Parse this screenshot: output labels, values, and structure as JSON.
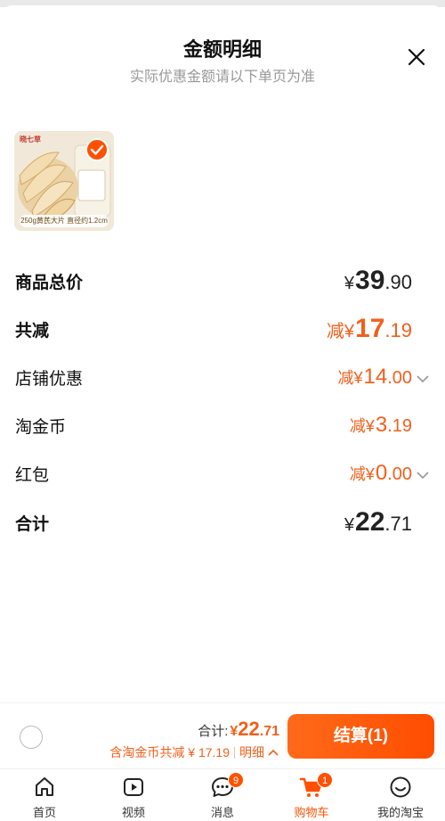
{
  "header": {
    "title": "金额明细",
    "subtitle": "实际优惠金额请以下单页为准"
  },
  "product": {
    "brand": "晓七草",
    "caption": "250g黄芪大片 直径约1.2cm",
    "selected": true
  },
  "rows": {
    "subtotal": {
      "label": "商品总价",
      "prefix": "¥",
      "int": "39",
      "dec": ".90"
    },
    "total_discount": {
      "label": "共减",
      "prefix": "减¥",
      "int": "17",
      "dec": ".19"
    },
    "shop_discount": {
      "label": "店铺优惠",
      "prefix": "减¥",
      "int": "14",
      "dec": ".00"
    },
    "taojinbi": {
      "label": "淘金币",
      "prefix": "减¥",
      "int": "3",
      "dec": ".19"
    },
    "red_packet": {
      "label": "红包",
      "prefix": "减¥",
      "int": "0",
      "dec": ".00"
    },
    "total": {
      "label": "合计",
      "prefix": "¥",
      "int": "22",
      "dec": ".71"
    }
  },
  "footer": {
    "total_label": "合计:",
    "total_prefix": "¥",
    "total_int": "22",
    "total_dec": ".71",
    "note": "含淘金币共减 ¥ 17.19",
    "detail_label": "明细",
    "checkout_label": "结算(1)"
  },
  "tabs": [
    {
      "label": "首页",
      "icon": "home-icon"
    },
    {
      "label": "视频",
      "icon": "video-icon"
    },
    {
      "label": "消息",
      "icon": "message-icon",
      "badge": "9"
    },
    {
      "label": "购物车",
      "icon": "cart-icon",
      "badge": "1",
      "active": true
    },
    {
      "label": "我的淘宝",
      "icon": "profile-icon"
    }
  ],
  "colors": {
    "accent": "#ff5000",
    "discount": "#f0601c"
  }
}
